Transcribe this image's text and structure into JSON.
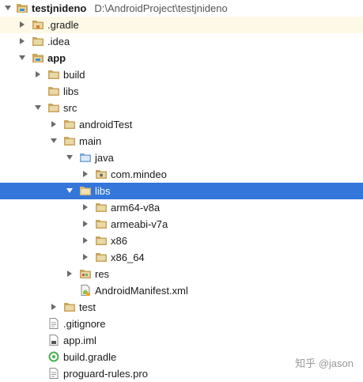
{
  "project_tree": {
    "root": {
      "label": "testjnideno",
      "path": "D:\\AndroidProject\\testjnideno"
    },
    "items": [
      {
        "label": ".gradle"
      },
      {
        "label": ".idea"
      },
      {
        "label": "app"
      },
      {
        "label": "build"
      },
      {
        "label": "libs"
      },
      {
        "label": "src"
      },
      {
        "label": "androidTest"
      },
      {
        "label": "main"
      },
      {
        "label": "java"
      },
      {
        "label": "com.mindeo"
      },
      {
        "label": "libs"
      },
      {
        "label": "arm64-v8a"
      },
      {
        "label": "armeabi-v7a"
      },
      {
        "label": "x86"
      },
      {
        "label": "x86_64"
      },
      {
        "label": "res"
      },
      {
        "label": "AndroidManifest.xml"
      },
      {
        "label": "test"
      },
      {
        "label": ".gitignore"
      },
      {
        "label": "app.iml"
      },
      {
        "label": "build.gradle"
      },
      {
        "label": "proguard-rules.pro"
      }
    ]
  },
  "watermark": "知乎 @jason",
  "colors": {
    "selection": "#3476d9",
    "highlight_row": "#fdf9e6",
    "folder": "#c9a45a",
    "source_folder": "#7aa7d8"
  }
}
